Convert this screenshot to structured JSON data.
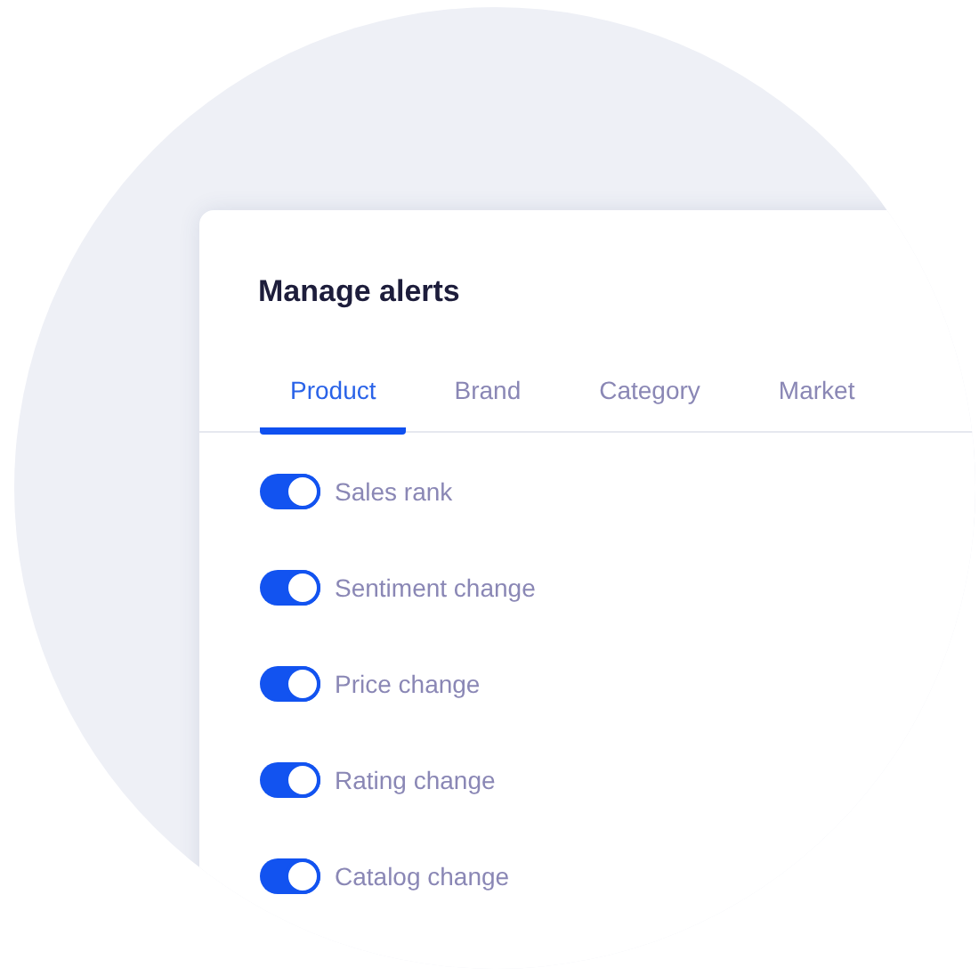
{
  "panel": {
    "title": "Manage alerts"
  },
  "tabs": [
    {
      "label": "Product",
      "selected": true
    },
    {
      "label": "Brand",
      "selected": false
    },
    {
      "label": "Category",
      "selected": false
    },
    {
      "label": "Market",
      "selected": false
    }
  ],
  "alerts": [
    {
      "label": "Sales rank",
      "on": true
    },
    {
      "label": "Sentiment change",
      "on": true
    },
    {
      "label": "Price change",
      "on": true
    },
    {
      "label": "Rating change",
      "on": true
    },
    {
      "label": "Catalog change",
      "on": true
    }
  ]
}
